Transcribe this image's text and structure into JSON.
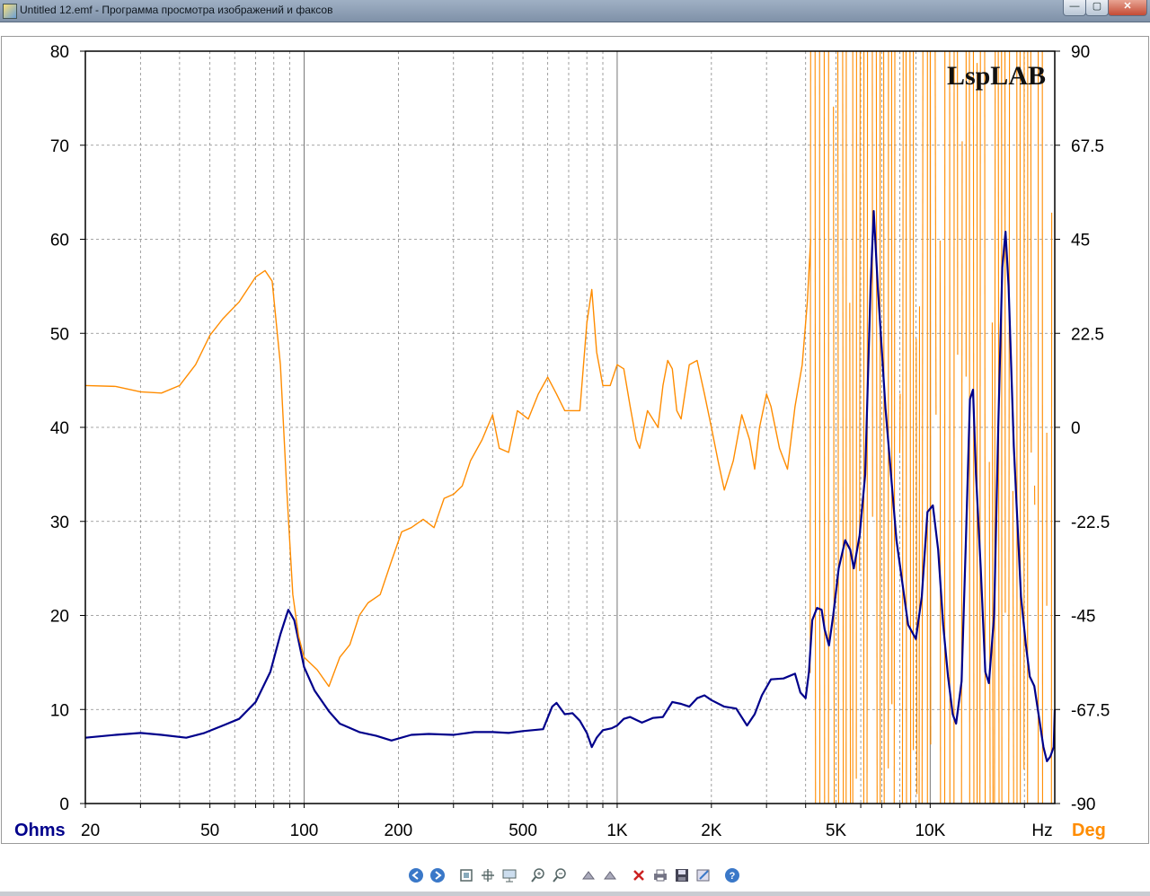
{
  "window": {
    "title": "Untitled 12.emf - Программа просмотра изображений и факсов",
    "buttons": {
      "minimize": "—",
      "maximize": "▢",
      "close": "✕"
    }
  },
  "toolbar": {
    "icons": [
      "prev-icon",
      "next-icon",
      "best-fit-icon",
      "actual-size-icon",
      "slideshow-icon",
      "zoom-in-icon",
      "zoom-out-icon",
      "rotate-cw-icon",
      "rotate-ccw-icon",
      "delete-icon",
      "print-icon",
      "save-icon",
      "edit-icon",
      "help-icon"
    ]
  },
  "chart_data": {
    "type": "line",
    "title": "LspLAB",
    "x_scale": "log",
    "xlim": [
      20,
      25000
    ],
    "x_ticks": [
      20,
      50,
      100,
      200,
      500,
      1000,
      2000,
      5000,
      10000
    ],
    "x_tick_labels": [
      "20",
      "50",
      "100",
      "200",
      "500",
      "1K",
      "2K",
      "5K",
      "10K"
    ],
    "x_unit_label": "Hz",
    "y_left": {
      "label": "Ohms",
      "lim": [
        0,
        80
      ],
      "ticks": [
        "0",
        "10",
        "20",
        "30",
        "40",
        "50",
        "60",
        "70",
        "80"
      ]
    },
    "y_right": {
      "label": "Deg",
      "lim": [
        -90,
        90
      ],
      "ticks": [
        "-90",
        "-67.5",
        "-45",
        "-22.5",
        "0",
        "22.5",
        "45",
        "67.5",
        "90"
      ]
    },
    "grid": true,
    "colors": {
      "impedance": "#00008b",
      "phase": "#ff8c00",
      "grid": "#666666"
    },
    "series": [
      {
        "axis": "left",
        "points": [
          [
            20,
            7
          ],
          [
            25,
            7.3
          ],
          [
            30,
            7.5
          ],
          [
            35,
            7.3
          ],
          [
            42,
            7
          ],
          [
            48,
            7.5
          ],
          [
            55,
            8.3
          ],
          [
            62,
            9
          ],
          [
            70,
            10.8
          ],
          [
            78,
            14
          ],
          [
            84,
            18
          ],
          [
            89,
            20.6
          ],
          [
            93,
            19.5
          ],
          [
            100,
            14.5
          ],
          [
            108,
            12
          ],
          [
            120,
            9.8
          ],
          [
            130,
            8.5
          ],
          [
            150,
            7.6
          ],
          [
            170,
            7.2
          ],
          [
            190,
            6.7
          ],
          [
            220,
            7.3
          ],
          [
            250,
            7.4
          ],
          [
            300,
            7.3
          ],
          [
            350,
            7.6
          ],
          [
            400,
            7.6
          ],
          [
            450,
            7.5
          ],
          [
            500,
            7.7
          ],
          [
            580,
            7.9
          ],
          [
            620,
            10.3
          ],
          [
            640,
            10.7
          ],
          [
            680,
            9.5
          ],
          [
            720,
            9.6
          ],
          [
            760,
            8.8
          ],
          [
            800,
            7.5
          ],
          [
            830,
            6
          ],
          [
            860,
            7
          ],
          [
            900,
            7.8
          ],
          [
            960,
            8
          ],
          [
            1000,
            8.3
          ],
          [
            1050,
            9
          ],
          [
            1100,
            9.2
          ],
          [
            1200,
            8.6
          ],
          [
            1300,
            9.1
          ],
          [
            1400,
            9.2
          ],
          [
            1500,
            10.8
          ],
          [
            1600,
            10.6
          ],
          [
            1700,
            10.3
          ],
          [
            1800,
            11.2
          ],
          [
            1900,
            11.5
          ],
          [
            2000,
            11
          ],
          [
            2200,
            10.3
          ],
          [
            2400,
            10.1
          ],
          [
            2600,
            8.3
          ],
          [
            2750,
            9.5
          ],
          [
            2900,
            11.5
          ],
          [
            3100,
            13.2
          ],
          [
            3400,
            13.3
          ],
          [
            3700,
            13.8
          ],
          [
            3850,
            11.8
          ],
          [
            4000,
            11.2
          ],
          [
            4100,
            14
          ],
          [
            4200,
            19.5
          ],
          [
            4350,
            20.8
          ],
          [
            4500,
            20.6
          ],
          [
            4600,
            18.5
          ],
          [
            4750,
            16.8
          ],
          [
            4900,
            20
          ],
          [
            5100,
            25
          ],
          [
            5350,
            28
          ],
          [
            5550,
            27
          ],
          [
            5700,
            25
          ],
          [
            5950,
            28.5
          ],
          [
            6200,
            35
          ],
          [
            6450,
            55
          ],
          [
            6600,
            63
          ],
          [
            6800,
            55
          ],
          [
            7200,
            42
          ],
          [
            7800,
            28
          ],
          [
            8500,
            19
          ],
          [
            9000,
            17.5
          ],
          [
            9400,
            22
          ],
          [
            9800,
            31
          ],
          [
            10200,
            31.7
          ],
          [
            10600,
            27
          ],
          [
            11000,
            19
          ],
          [
            11400,
            13.5
          ],
          [
            11800,
            9.5
          ],
          [
            12100,
            8.5
          ],
          [
            12600,
            13
          ],
          [
            13000,
            28
          ],
          [
            13400,
            43
          ],
          [
            13700,
            44
          ],
          [
            14000,
            35
          ],
          [
            14500,
            25
          ],
          [
            15000,
            14
          ],
          [
            15400,
            12.8
          ],
          [
            16000,
            20
          ],
          [
            16500,
            40
          ],
          [
            17000,
            57
          ],
          [
            17400,
            60.8
          ],
          [
            17800,
            55
          ],
          [
            18500,
            38
          ],
          [
            19500,
            22
          ],
          [
            20200,
            17
          ],
          [
            20800,
            13.5
          ],
          [
            21500,
            12.5
          ],
          [
            22300,
            9
          ],
          [
            23000,
            6
          ],
          [
            23600,
            4.5
          ],
          [
            24200,
            5
          ],
          [
            24800,
            6
          ],
          [
            25000,
            10
          ]
        ]
      },
      {
        "axis": "right",
        "points": [
          [
            20,
            10
          ],
          [
            25,
            9.8
          ],
          [
            30,
            8.5
          ],
          [
            35,
            8.2
          ],
          [
            40,
            10
          ],
          [
            45,
            15
          ],
          [
            50,
            22
          ],
          [
            55,
            26
          ],
          [
            62,
            30
          ],
          [
            70,
            36
          ],
          [
            75,
            37.5
          ],
          [
            79,
            35
          ],
          [
            84,
            15
          ],
          [
            88,
            -15
          ],
          [
            92,
            -40
          ],
          [
            96,
            -50
          ],
          [
            100,
            -55
          ],
          [
            110,
            -58
          ],
          [
            120,
            -62
          ],
          [
            130,
            -55
          ],
          [
            140,
            -52
          ],
          [
            150,
            -45
          ],
          [
            160,
            -42
          ],
          [
            175,
            -40
          ],
          [
            190,
            -32
          ],
          [
            205,
            -25
          ],
          [
            220,
            -24
          ],
          [
            240,
            -22
          ],
          [
            260,
            -24
          ],
          [
            280,
            -17
          ],
          [
            300,
            -16
          ],
          [
            320,
            -14
          ],
          [
            340,
            -8
          ],
          [
            370,
            -3
          ],
          [
            400,
            3
          ],
          [
            420,
            -5
          ],
          [
            450,
            -6
          ],
          [
            480,
            4
          ],
          [
            520,
            2
          ],
          [
            560,
            8
          ],
          [
            600,
            12
          ],
          [
            640,
            8
          ],
          [
            680,
            4
          ],
          [
            720,
            4
          ],
          [
            760,
            4
          ],
          [
            800,
            25
          ],
          [
            830,
            33
          ],
          [
            860,
            18
          ],
          [
            900,
            10
          ],
          [
            950,
            10
          ],
          [
            1000,
            15
          ],
          [
            1050,
            14
          ],
          [
            1100,
            5
          ],
          [
            1150,
            -3
          ],
          [
            1180,
            -5
          ],
          [
            1250,
            4
          ],
          [
            1350,
            0
          ],
          [
            1400,
            10
          ],
          [
            1450,
            16
          ],
          [
            1500,
            14
          ],
          [
            1550,
            4
          ],
          [
            1600,
            2
          ],
          [
            1700,
            15
          ],
          [
            1800,
            16
          ],
          [
            1900,
            8
          ],
          [
            2000,
            0
          ],
          [
            2100,
            -8
          ],
          [
            2200,
            -15
          ],
          [
            2350,
            -8
          ],
          [
            2500,
            3
          ],
          [
            2650,
            -3
          ],
          [
            2750,
            -10
          ],
          [
            2850,
            0
          ],
          [
            3000,
            8
          ],
          [
            3100,
            5
          ],
          [
            3300,
            -5
          ],
          [
            3500,
            -10
          ],
          [
            3700,
            5
          ],
          [
            3900,
            15
          ],
          [
            4050,
            30
          ],
          [
            4150,
            45
          ]
        ]
      }
    ],
    "phase_noise": {
      "x_start": 4150,
      "x_end": 25000,
      "ylim": [
        -90,
        90
      ]
    }
  }
}
